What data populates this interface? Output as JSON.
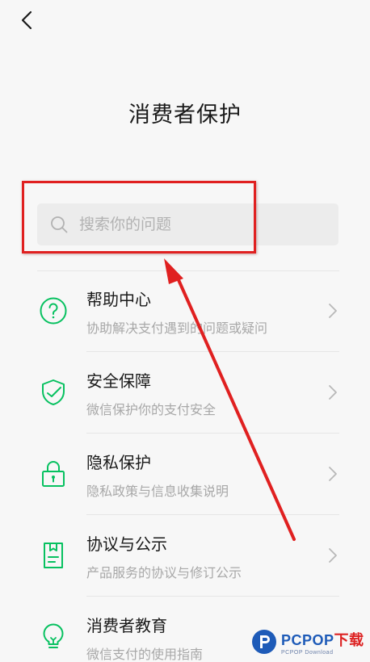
{
  "header": {
    "back_icon": "chevron-left-icon",
    "title": "消费者保护"
  },
  "search": {
    "icon": "search-icon",
    "placeholder": "搜索你的问题",
    "value": ""
  },
  "menu": {
    "items": [
      {
        "icon": "question-circle-icon",
        "title": "帮助中心",
        "subtitle": "协助解决支付遇到的问题或疑问"
      },
      {
        "icon": "shield-check-icon",
        "title": "安全保障",
        "subtitle": "微信保护你的支付安全"
      },
      {
        "icon": "lock-icon",
        "title": "隐私保护",
        "subtitle": "隐私政策与信息收集说明"
      },
      {
        "icon": "document-icon",
        "title": "协议与公示",
        "subtitle": "产品服务的协议与修订公示"
      },
      {
        "icon": "lightbulb-icon",
        "title": "消费者教育",
        "subtitle": "微信支付的使用指南"
      }
    ]
  },
  "annotation": {
    "highlight_color": "#e02020",
    "arrow_color": "#e02020"
  },
  "watermark": {
    "main": "PCPOP",
    "accent": "下载",
    "sub": "PCPOP Download"
  },
  "colors": {
    "accent": "#07c160",
    "background": "#f7f7f7"
  }
}
